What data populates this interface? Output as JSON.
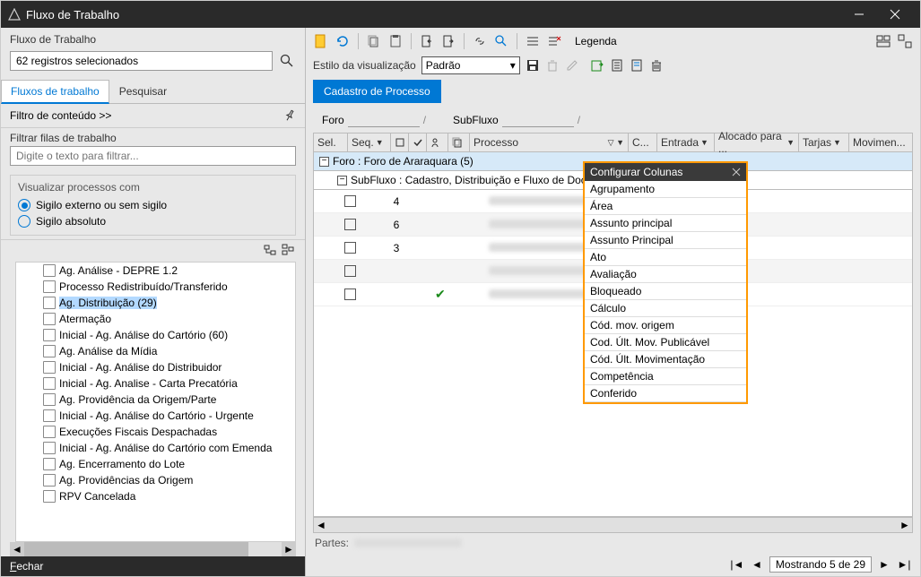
{
  "window": {
    "title": "Fluxo de Trabalho"
  },
  "left": {
    "header_label": "Fluxo de Trabalho",
    "search_value": "62 registros selecionados",
    "tabs": {
      "workflows": "Fluxos de trabalho",
      "search": "Pesquisar"
    },
    "filter_header": "Filtro de conteúdo >>",
    "filter_queues_label": "Filtrar filas de trabalho",
    "filter_placeholder": "Digite o texto para filtrar...",
    "vis_group_title": "Visualizar processos com",
    "radio_external": "Sigilo externo ou sem sigilo",
    "radio_absolute": "Sigilo absoluto",
    "tree": [
      "Ag. Análise - DEPRE 1.2",
      "Processo Redistribuído/Transferido",
      "Ag. Distribuição (29)",
      "Atermação",
      "Inicial - Ag. Análise do Cartório (60)",
      "Ag. Análise da Mídia",
      "Inicial  - Ag. Análise do Distribuidor",
      "Inicial - Ag. Analise - Carta Precatória",
      "Ag. Providência da Origem/Parte",
      "Inicial - Ag. Análise do Cartório - Urgente",
      "Execuções Fiscais Despachadas",
      "Inicial - Ag. Análise do Cartório com Emenda",
      "Ag. Encerramento do Lote",
      "Ag. Providências da Origem",
      "RPV Cancelada"
    ],
    "tree_selected_index": 2,
    "close_btn": {
      "prefix": "F",
      "rest": "echar"
    }
  },
  "right": {
    "legend": "Legenda",
    "vis_style_label": "Estilo da visualização",
    "vis_style_value": "Padrão",
    "sub_tab": "Cadastro de Processo",
    "foro_label": "Foro",
    "foro_value": "",
    "subfluxo_label": "SubFluxo",
    "subfluxo_value": "",
    "columns": {
      "sel": "Sel.",
      "seq": "Seq.",
      "proc": "Processo",
      "c": "C...",
      "entrada": "Entrada",
      "alocado": "Alocado para ...",
      "tarjas": "Tarjas",
      "movim": "Movimen..."
    },
    "group1": "Foro : Foro de Araraquara  (5)",
    "group2": "SubFluxo : Cadastro, Distribuição e Fluxo de Docu...",
    "rows": [
      {
        "seq": "4",
        "checked": false
      },
      {
        "seq": "6",
        "checked": false
      },
      {
        "seq": "3",
        "checked": false
      },
      {
        "seq": "",
        "checked": false
      },
      {
        "seq": "",
        "checked": true
      }
    ],
    "col_config": {
      "title": "Configurar Colunas",
      "options": [
        "Agrupamento",
        "Área",
        "Assunto principal",
        "Assunto Principal",
        "Ato",
        "Avaliação",
        "Bloqueado",
        "Cálculo",
        "Cód. mov. origem",
        "Cod. Últ. Mov. Publicável",
        "Cód. Últ. Movimentação",
        "Competência",
        "Conferido"
      ]
    },
    "partes_label": "Partes:",
    "pager_text": "Mostrando 5 de 29"
  }
}
